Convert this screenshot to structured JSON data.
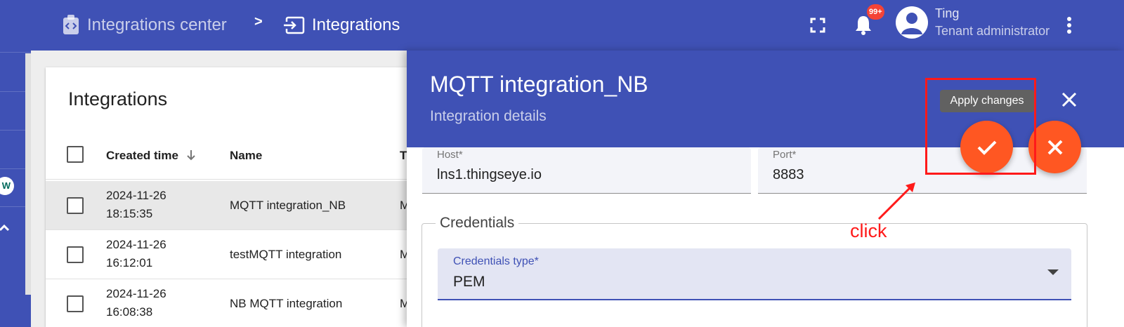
{
  "rail": {
    "badge_text": "W"
  },
  "topbar": {
    "breadcrumb_root": "Integrations center",
    "breadcrumb_separator": ">",
    "breadcrumb_current": "Integrations",
    "notifications_badge": "99+",
    "user_name": "Ting",
    "user_role": "Tenant administrator",
    "icons": [
      "fullscreen-icon",
      "notifications-icon",
      "account-icon",
      "more-vert-icon"
    ]
  },
  "table": {
    "title": "Integrations",
    "columns": {
      "created_time": "Created time",
      "name": "Name",
      "type": "T"
    },
    "rows": [
      {
        "date": "2024-11-26",
        "time": "18:15:35",
        "name": "MQTT integration_NB",
        "type": "M",
        "selected": true
      },
      {
        "date": "2024-11-26",
        "time": "16:12:01",
        "name": "testMQTT integration",
        "type": "M",
        "selected": false
      },
      {
        "date": "2024-11-26",
        "time": "16:08:38",
        "name": "NB MQTT integration",
        "type": "M",
        "selected": false
      }
    ]
  },
  "panel": {
    "title": "MQTT integration_NB",
    "subtitle": "Integration details",
    "host_label": "Host*",
    "host_value": "lns1.thingseye.io",
    "port_label": "Port*",
    "port_value": "8883",
    "credentials_legend": "Credentials",
    "credentials_type_label": "Credentials type*",
    "credentials_type_value": "PEM",
    "apply_tooltip": "Apply changes"
  },
  "annotation": {
    "text": "click",
    "color": "#ff1a1a"
  },
  "colors": {
    "primary": "#3f51b5",
    "accent": "#ff5722",
    "badge": "#f44336"
  }
}
